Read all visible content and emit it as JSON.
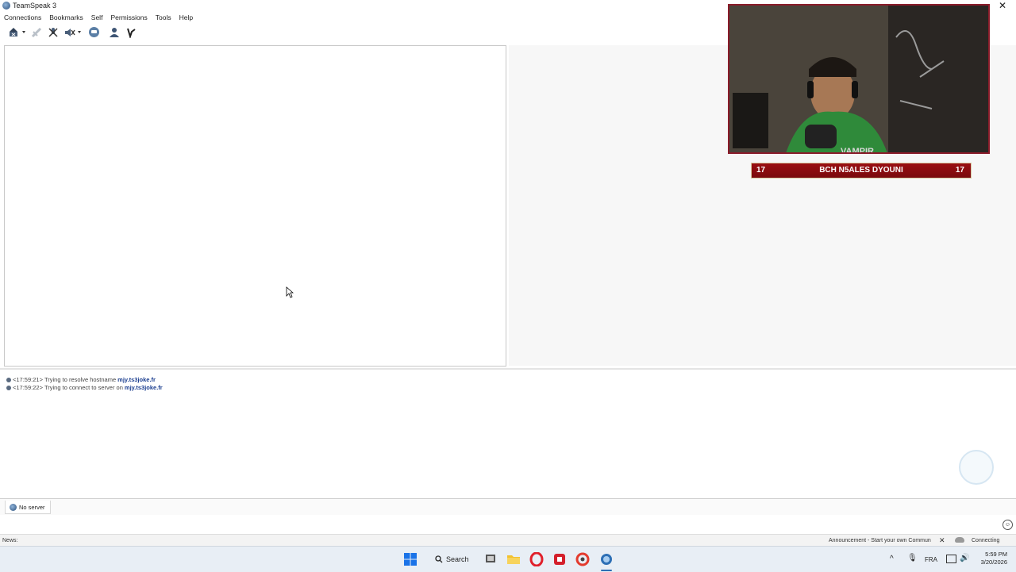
{
  "window": {
    "title": "TeamSpeak 3",
    "close_glyph": "✕"
  },
  "menu": [
    "Connections",
    "Bookmarks",
    "Self",
    "Permissions",
    "Tools",
    "Help"
  ],
  "toolbar": {
    "icons": [
      "connect-icon",
      "disconnect-icon",
      "mute-microphone-icon",
      "mute-speakers-icon",
      "away-status-icon",
      "contacts-icon",
      "privilege-key-icon"
    ]
  },
  "log": [
    {
      "time": "<17:59:21>",
      "text": "Trying to resolve hostname",
      "host": "mjy.ts3joke.fr"
    },
    {
      "time": "<17:59:22>",
      "text": "Trying to connect to server on",
      "host": "mjy.ts3joke.fr"
    }
  ],
  "tabs": [
    {
      "label": "No server"
    }
  ],
  "chat": {
    "placeholder": ""
  },
  "status": {
    "news_label": "News:",
    "announcement": "Announcement - Start your own Commun",
    "connection_state": "Connecting"
  },
  "webcam": {
    "nameplate": {
      "left_number": "17",
      "name": "BCH N5ALES DYOUNI",
      "right_number": "17"
    },
    "brand_overlay": "VAMPIR"
  },
  "taskbar": {
    "search_label": "Search",
    "language": "FRA",
    "time": "5:59 PM",
    "date": "3/20/2026",
    "apps": [
      "windows-start-icon",
      "search-icon",
      "task-view-icon",
      "file-explorer-icon",
      "opera-icon",
      "app-red-icon",
      "chrome-icon",
      "teamspeak-icon"
    ]
  },
  "colors": {
    "accent_red": "#8a1c2a",
    "host_link": "#1a3d8f",
    "nameplate_bg": "#9a0f12"
  }
}
